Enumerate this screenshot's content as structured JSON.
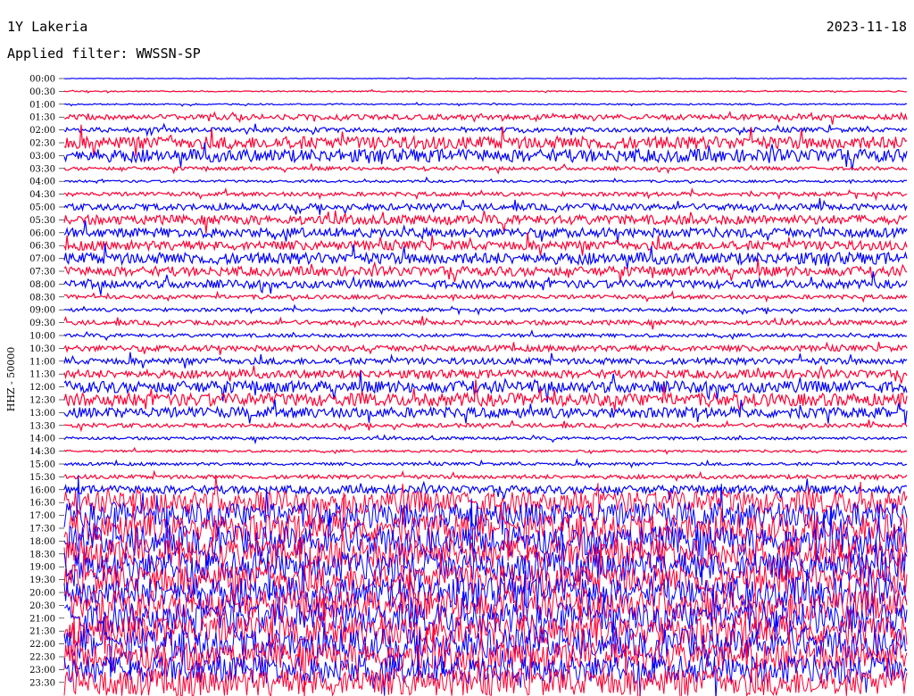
{
  "header": {
    "station": "1Y Lakeria",
    "date": "2023-11-18",
    "filter_text": "Applied filter: WWSSN-SP"
  },
  "chart_data": {
    "type": "line",
    "ylabel": "HHZ - 50000",
    "time_labels": [
      "00:00",
      "00:30",
      "01:00",
      "01:30",
      "02:00",
      "02:30",
      "03:00",
      "03:30",
      "04:00",
      "04:30",
      "05:00",
      "05:30",
      "06:00",
      "06:30",
      "07:00",
      "07:30",
      "08:00",
      "08:30",
      "09:00",
      "09:30",
      "10:00",
      "10:30",
      "11:00",
      "11:30",
      "12:00",
      "12:30",
      "13:00",
      "13:30",
      "14:00",
      "14:30",
      "15:00",
      "15:30",
      "16:00",
      "16:30",
      "17:00",
      "17:30",
      "18:00",
      "18:30",
      "19:00",
      "19:30",
      "20:00",
      "20:30",
      "21:00",
      "21:30",
      "22:00",
      "22:30",
      "23:00",
      "23:30"
    ],
    "trace_colors": [
      "#0000ff",
      "#ff0033"
    ],
    "relative_amplitude": [
      0.05,
      0.1,
      0.12,
      0.45,
      0.4,
      1.1,
      1.1,
      0.3,
      0.2,
      0.35,
      0.55,
      0.8,
      0.8,
      0.8,
      1.0,
      0.8,
      0.7,
      0.35,
      0.3,
      0.4,
      0.3,
      0.5,
      0.55,
      0.7,
      1.0,
      1.1,
      0.9,
      0.35,
      0.25,
      0.2,
      0.25,
      0.35,
      0.7,
      2.0,
      2.2,
      2.5,
      2.6,
      2.6,
      2.6,
      2.6,
      2.6,
      2.6,
      2.6,
      2.6,
      2.6,
      2.5,
      2.4,
      2.4
    ]
  }
}
